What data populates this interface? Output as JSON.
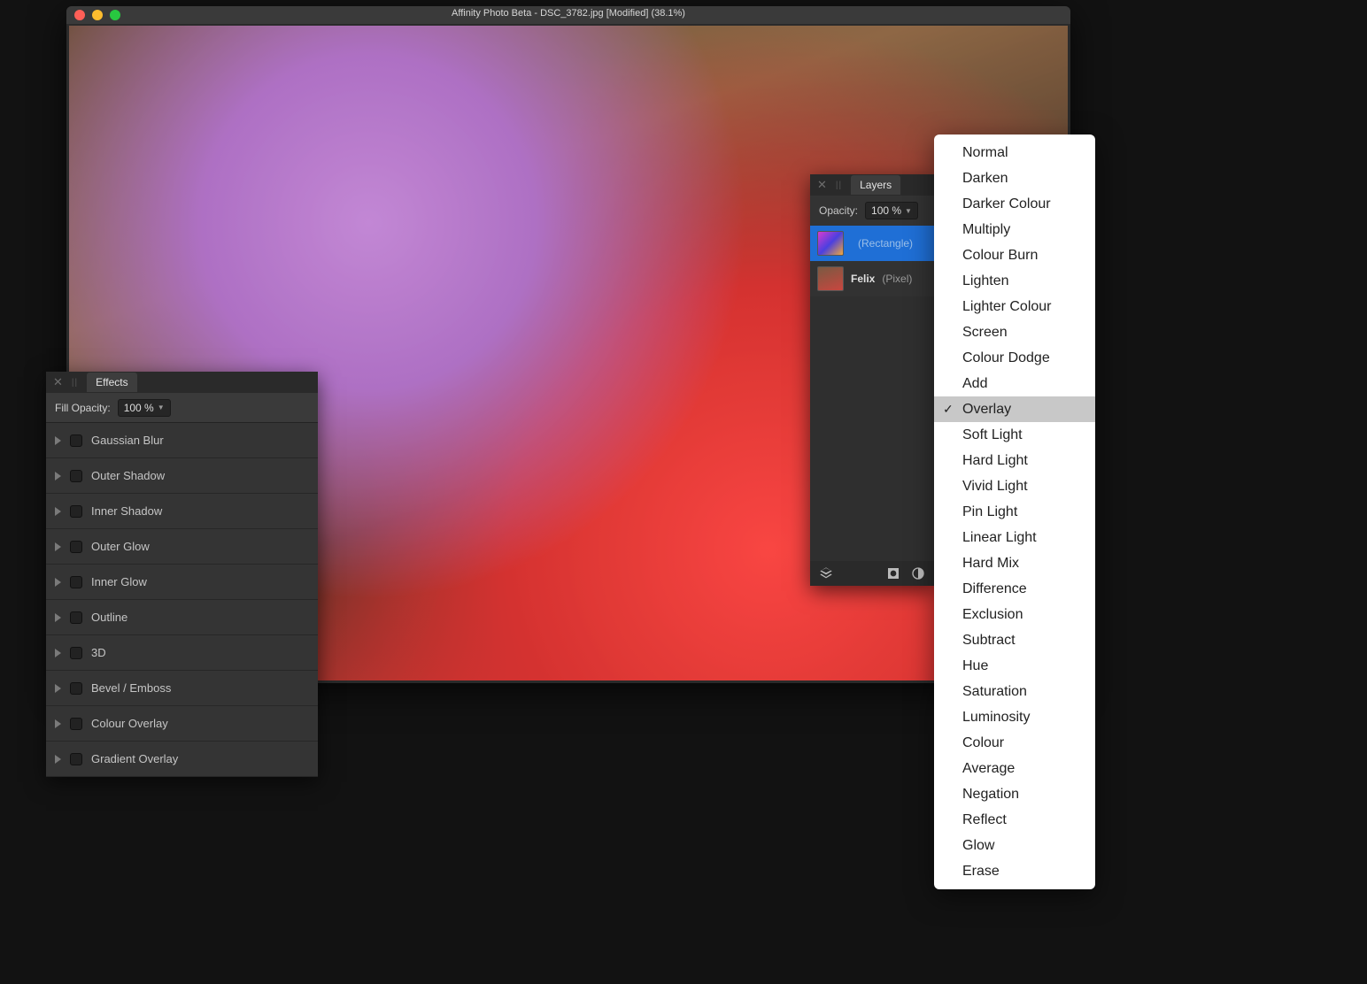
{
  "window": {
    "title": "Affinity Photo Beta - DSC_3782.jpg [Modified] (38.1%)"
  },
  "effects_panel": {
    "tab": "Effects",
    "fill_opacity_label": "Fill Opacity:",
    "fill_opacity_value": "100 %",
    "rows": [
      "Gaussian Blur",
      "Outer Shadow",
      "Inner Shadow",
      "Outer Glow",
      "Inner Glow",
      "Outline",
      "3D",
      "Bevel / Emboss",
      "Colour Overlay",
      "Gradient Overlay"
    ]
  },
  "layers_panel": {
    "tab": "Layers",
    "opacity_label": "Opacity:",
    "opacity_value": "100 %",
    "layers": [
      {
        "name": "",
        "type": "(Rectangle)",
        "selected": true
      },
      {
        "name": "Felix",
        "type": "(Pixel)",
        "selected": false
      }
    ]
  },
  "blend_popup": {
    "selected": "Overlay",
    "items": [
      "Normal",
      "Darken",
      "Darker Colour",
      "Multiply",
      "Colour Burn",
      "Lighten",
      "Lighter Colour",
      "Screen",
      "Colour Dodge",
      "Add",
      "Overlay",
      "Soft Light",
      "Hard Light",
      "Vivid Light",
      "Pin Light",
      "Linear Light",
      "Hard Mix",
      "Difference",
      "Exclusion",
      "Subtract",
      "Hue",
      "Saturation",
      "Luminosity",
      "Colour",
      "Average",
      "Negation",
      "Reflect",
      "Glow",
      "Erase"
    ]
  }
}
